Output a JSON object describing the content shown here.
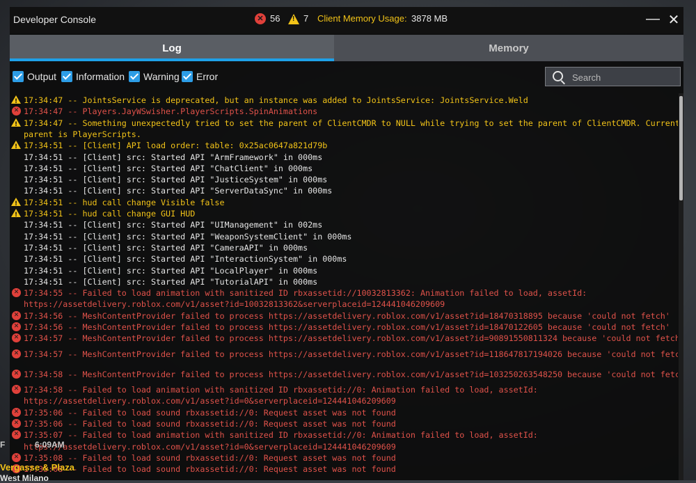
{
  "window": {
    "title": "Developer Console",
    "error_count": "56",
    "warning_count": "7",
    "memory_label": "Client Memory Usage:",
    "memory_value": "3878 MB",
    "minimize_glyph": "—",
    "close_glyph": "✕"
  },
  "tabs": [
    {
      "label": "Log",
      "active": true
    },
    {
      "label": "Memory",
      "active": false
    }
  ],
  "filters": [
    {
      "label": "Output",
      "checked": true
    },
    {
      "label": "Information",
      "checked": true
    },
    {
      "label": "Warning",
      "checked": true
    },
    {
      "label": "Error",
      "checked": true
    }
  ],
  "search": {
    "placeholder": "Search",
    "value": ""
  },
  "log": [
    {
      "type": "warning",
      "text": "17:34:47 -- JointsService is deprecated, but an instance was added to JointsService: JointsService.Weld"
    },
    {
      "type": "error",
      "text": "17:34:47 -- Players.JayWSwisher.PlayerScripts.SpinAnimations"
    },
    {
      "type": "warning",
      "text": "17:34:47 -- Something unexpectedly tried to set the parent of ClientCMDR to NULL while trying to set the parent of ClientCMDR. Current\nparent is PlayerScripts."
    },
    {
      "type": "warning",
      "text": "17:34:51 -- [Client] API load order: table: 0x25ac0647a821d79b"
    },
    {
      "type": "output",
      "text": "17:34:51 -- [Client] src: Started API \"ArmFramework\" in 000ms"
    },
    {
      "type": "output",
      "text": "17:34:51 -- [Client] src: Started API \"ChatClient\" in 000ms"
    },
    {
      "type": "output",
      "text": "17:34:51 -- [Client] src: Started API \"JusticeSystem\" in 000ms"
    },
    {
      "type": "output",
      "text": "17:34:51 -- [Client] src: Started API \"ServerDataSync\" in 000ms"
    },
    {
      "type": "warning",
      "text": "17:34:51 -- hud call change Visible false"
    },
    {
      "type": "warning",
      "text": "17:34:51 -- hud call change GUI HUD"
    },
    {
      "type": "output",
      "text": "17:34:51 -- [Client] src: Started API \"UIManagement\" in 002ms"
    },
    {
      "type": "output",
      "text": "17:34:51 -- [Client] src: Started API \"WeaponSystemClient\" in 000ms"
    },
    {
      "type": "output",
      "text": "17:34:51 -- [Client] src: Started API \"CameraAPI\" in 000ms"
    },
    {
      "type": "output",
      "text": "17:34:51 -- [Client] src: Started API \"InteractionSystem\" in 000ms"
    },
    {
      "type": "output",
      "text": "17:34:51 -- [Client] src: Started API \"LocalPlayer\" in 000ms"
    },
    {
      "type": "output",
      "text": "17:34:51 -- [Client] src: Started API \"TutorialAPI\" in 000ms"
    },
    {
      "type": "error",
      "text": "17:34:55 -- Failed to load animation with sanitized ID rbxassetid://10032813362: Animation failed to load, assetId:\nhttps://assetdelivery.roblox.com/v1/asset?id=10032813362&serverplaceid=124441046209609"
    },
    {
      "type": "error",
      "text": "17:34:56 -- MeshContentProvider failed to process https://assetdelivery.roblox.com/v1/asset?id=18470318895 because 'could not fetch'"
    },
    {
      "type": "error",
      "text": "17:34:56 -- MeshContentProvider failed to process https://assetdelivery.roblox.com/v1/asset?id=18470122605 because 'could not fetch'"
    },
    {
      "type": "error",
      "text": "17:34:57 -- MeshContentProvider failed to process https://assetdelivery.roblox.com/v1/asset?id=90891550811324 because 'could not fetch"
    },
    {
      "type": "error",
      "text": "17:34:57 -- MeshContentProvider failed to process https://assetdelivery.roblox.com/v1/asset?id=118647817194026 because 'could not fetc"
    },
    {
      "type": "error",
      "text": "17:34:58 -- MeshContentProvider failed to process https://assetdelivery.roblox.com/v1/asset?id=103250263548250 because 'could not fetc"
    },
    {
      "type": "error",
      "text": "17:34:58 -- Failed to load animation with sanitized ID rbxassetid://0: Animation failed to load, assetId:\nhttps://assetdelivery.roblox.com/v1/asset?id=0&serverplaceid=124441046209609"
    },
    {
      "type": "error",
      "text": "17:35:06 -- Failed to load sound rbxassetid://0: Request asset was not found"
    },
    {
      "type": "error",
      "text": "17:35:06 -- Failed to load sound rbxassetid://0: Request asset was not found"
    },
    {
      "type": "error",
      "text": "17:35:07 -- Failed to load animation with sanitized ID rbxassetid://0: Animation failed to load, assetId:\nhttps://assetdelivery.roblox.com/v1/asset?id=0&serverplaceid=124441046209609"
    },
    {
      "type": "error",
      "text": "17:35:08 -- Failed to load sound rbxassetid://0: Request asset was not found"
    },
    {
      "type": "error",
      "text": "17:35:08 -- Failed to load sound rbxassetid://0: Request asset was not found"
    }
  ],
  "hud": {
    "letter": "F",
    "time": "6:09AM",
    "location_1": "Vergasse & Plaza",
    "location_2": "West Milano"
  },
  "colors": {
    "accent": "#1ea1e8",
    "warning": "#f2c318",
    "error": "#e0524a",
    "output": "#e6e6e6"
  }
}
